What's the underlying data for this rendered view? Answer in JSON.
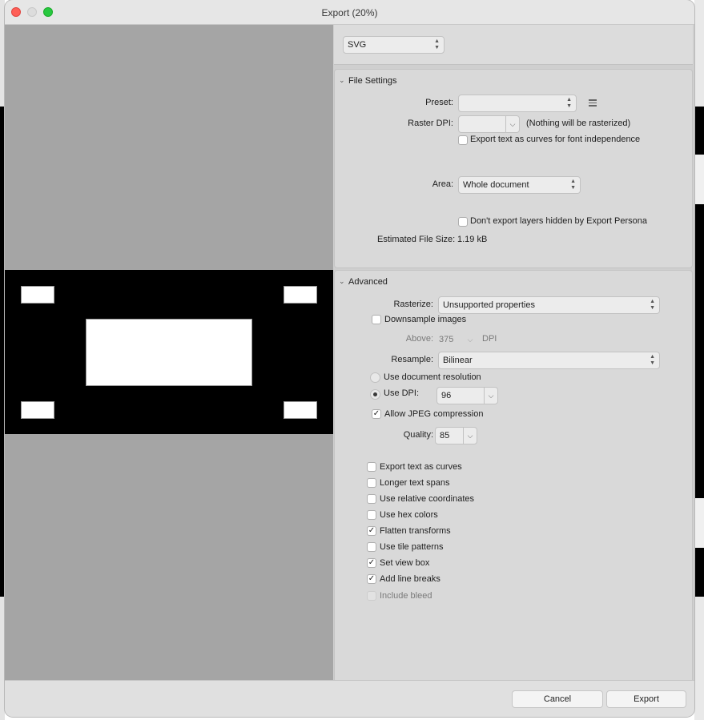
{
  "window": {
    "title": "Export (20%)"
  },
  "format": {
    "value": "SVG"
  },
  "file_settings": {
    "title": "File Settings",
    "preset_label": "Preset:",
    "preset_value": "",
    "raster_dpi_label": "Raster DPI:",
    "raster_dpi_value": "",
    "raster_note": "(Nothing will be rasterized)",
    "export_text_curves_label": "Export text as curves for font independence",
    "export_text_curves_checked": false,
    "area_label": "Area:",
    "area_value": "Whole document",
    "dont_export_hidden_label": "Don't export layers hidden by Export Persona",
    "dont_export_hidden_checked": false,
    "est_size_label": "Estimated File Size:",
    "est_size_value": "1.19 kB"
  },
  "advanced": {
    "title": "Advanced",
    "rasterize_label": "Rasterize:",
    "rasterize_value": "Unsupported properties",
    "downsample_label": "Downsample images",
    "above_label": "Above:",
    "above_value": "375",
    "above_unit": "DPI",
    "resample_label": "Resample:",
    "resample_value": "Bilinear",
    "use_doc_res_label": "Use document resolution",
    "use_dpi_label": "Use DPI:",
    "use_dpi_value": "96",
    "allow_jpeg_label": "Allow JPEG compression",
    "quality_label": "Quality:",
    "quality_value": "85",
    "options": [
      {
        "label": "Export text as curves",
        "checked": false
      },
      {
        "label": "Longer text spans",
        "checked": false
      },
      {
        "label": "Use relative coordinates",
        "checked": false
      },
      {
        "label": "Use hex colors",
        "checked": false
      },
      {
        "label": "Flatten transforms",
        "checked": true
      },
      {
        "label": "Use tile patterns",
        "checked": false
      },
      {
        "label": "Set view box",
        "checked": true
      },
      {
        "label": "Add line breaks",
        "checked": true
      },
      {
        "label": "Include bleed",
        "checked": false,
        "disabled": true
      }
    ]
  },
  "footer": {
    "cancel_label": "Cancel",
    "export_label": "Export"
  },
  "glyphs": {
    "check": "✓",
    "disclosure": "⌵",
    "chevron": "⌄"
  }
}
